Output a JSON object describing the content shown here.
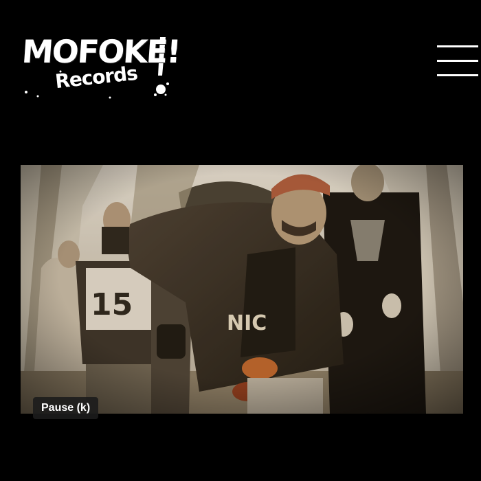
{
  "header": {
    "logo_main": "MOFOKE!",
    "logo_sub": "Records",
    "menu_icon": "hamburger-menu-icon"
  },
  "video": {
    "jersey_number": "15",
    "tooltip": "Pause (k)"
  },
  "colors": {
    "background": "#000000",
    "logo": "#ffffff",
    "tooltip_bg": "#1c1c1c"
  }
}
